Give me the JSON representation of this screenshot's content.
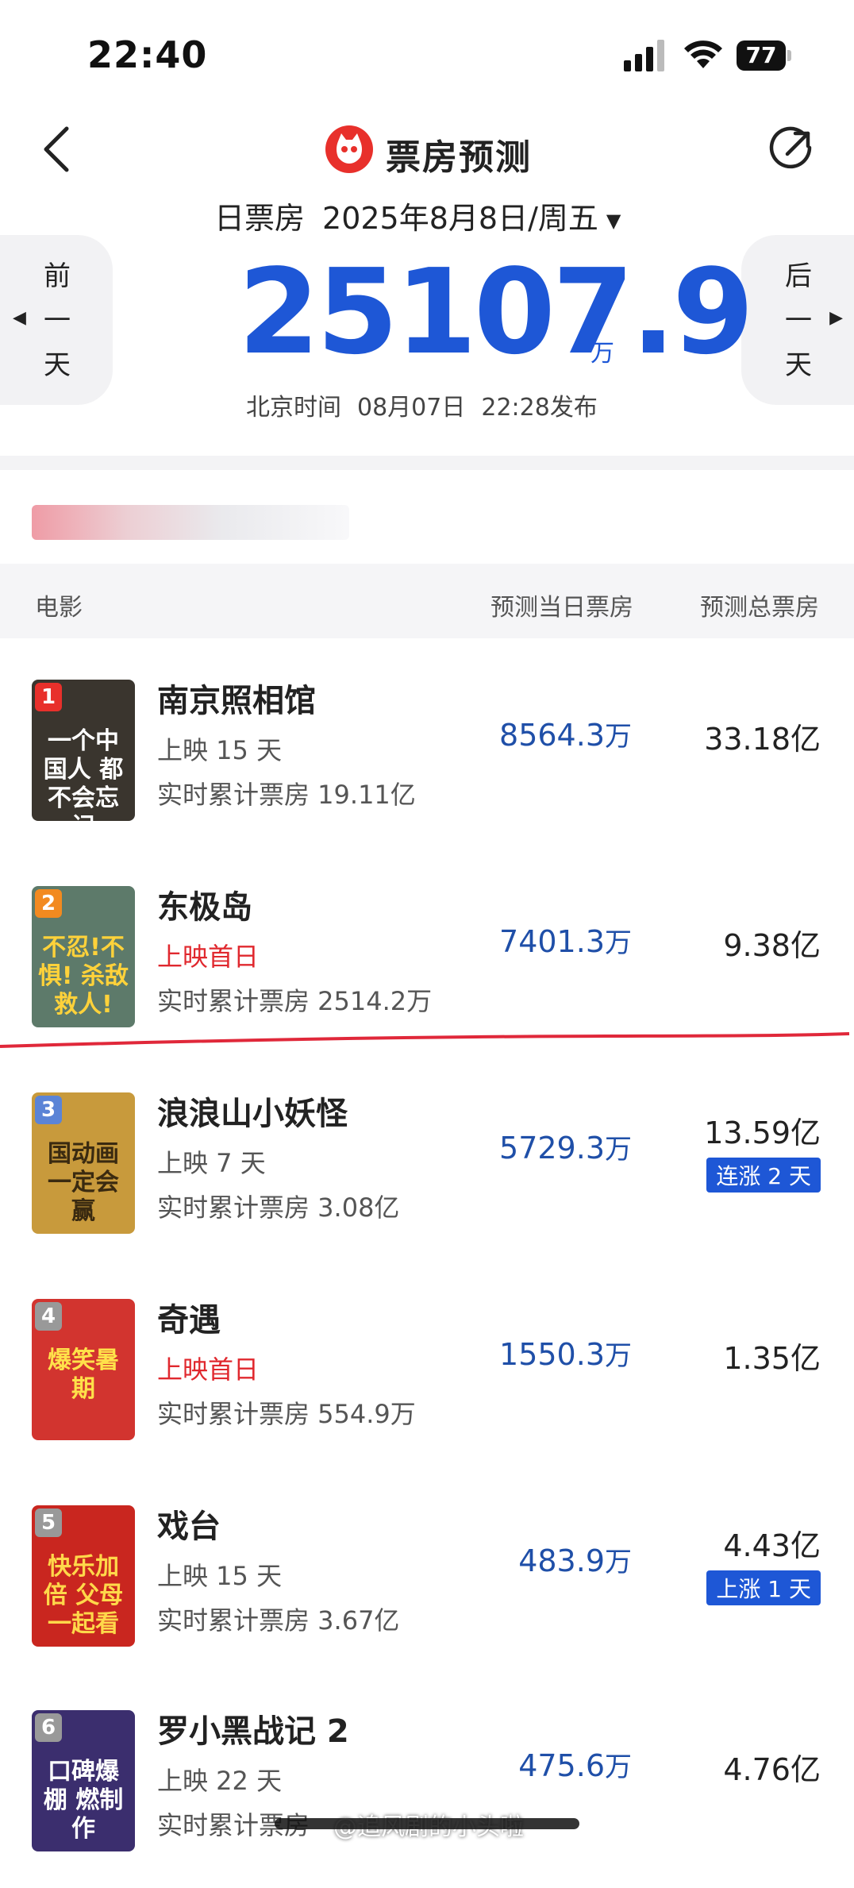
{
  "status": {
    "time": "22:40",
    "battery": "77"
  },
  "header": {
    "title": "票房预测",
    "date_label": "日票房",
    "date_value": "2025年8月8日/周五",
    "caret": "▼"
  },
  "nav": {
    "prev_label": [
      "前",
      "一",
      "天"
    ],
    "next_label": [
      "后",
      "一",
      "天"
    ]
  },
  "summary": {
    "total": "25107.9",
    "unit": "万",
    "publish_tz": "北京时间",
    "publish_date": "08月07日",
    "publish_time": "22:28发布"
  },
  "table": {
    "col_movie": "电影",
    "col_daily": "预测当日票房",
    "col_total": "预测总票房"
  },
  "movies": [
    {
      "rank": "1",
      "name": "南京照相馆",
      "days": "上映 15 天",
      "cumulative": "实时累计票房 19.11亿",
      "daily": "8564.3",
      "daily_unit": "万",
      "total": "33.18亿",
      "badge": "",
      "rank_color": "#e8302b"
    },
    {
      "rank": "2",
      "name": "东极岛",
      "days": "上映首日",
      "cumulative": "实时累计票房 2514.2万",
      "daily": "7401.3",
      "daily_unit": "万",
      "total": "9.38亿",
      "badge": "",
      "rank_color": "#f28a20"
    },
    {
      "rank": "3",
      "name": "浪浪山小妖怪",
      "days": "上映 7 天",
      "cumulative": "实时累计票房 3.08亿",
      "daily": "5729.3",
      "daily_unit": "万",
      "total": "13.59亿",
      "badge": "连涨 2 天",
      "rank_color": "#5b84d6"
    },
    {
      "rank": "4",
      "name": "奇遇",
      "days": "上映首日",
      "cumulative": "实时累计票房 554.9万",
      "daily": "1550.3",
      "daily_unit": "万",
      "total": "1.35亿",
      "badge": "",
      "rank_color": "#999999"
    },
    {
      "rank": "5",
      "name": "戏台",
      "days": "上映 15 天",
      "cumulative": "实时累计票房 3.67亿",
      "daily": "483.9",
      "daily_unit": "万",
      "total": "4.43亿",
      "badge": "上涨 1 天",
      "rank_color": "#999999"
    },
    {
      "rank": "6",
      "name": "罗小黑战记 2",
      "days": "上映 22 天",
      "cumulative": "实时累计票房",
      "daily": "475.6",
      "daily_unit": "万",
      "total": "4.76亿",
      "badge": "",
      "rank_color": "#999999"
    }
  ],
  "posters": [
    {
      "text": "一个中国人 都不会忘记",
      "bg": "#3a352e",
      "fg": "#ffffff"
    },
    {
      "text": "不忍!不惧! 杀敌救人!",
      "bg": "#5d7a6a",
      "fg": "#ffd23a"
    },
    {
      "text": "国动画 一定会赢",
      "bg": "#c89a3c",
      "fg": "#3a2a10"
    },
    {
      "text": "爆笑暑期",
      "bg": "#d2342f",
      "fg": "#ffe14a"
    },
    {
      "text": "快乐加倍 父母一起看",
      "bg": "#c9261f",
      "fg": "#ffd84a"
    },
    {
      "text": "口碑爆棚 燃制作",
      "bg": "#3b2e6e",
      "fg": "#ffffff"
    }
  ],
  "watermark": "@追风剧的小头啦"
}
